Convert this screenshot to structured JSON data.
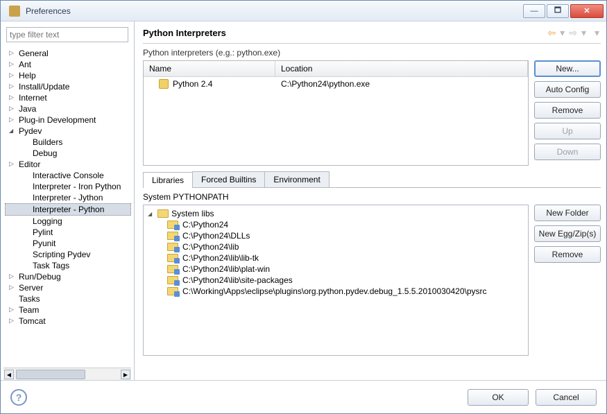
{
  "window_title": "Preferences",
  "filter_placeholder": "type filter text",
  "tree": {
    "items": [
      {
        "label": "General",
        "expandable": true
      },
      {
        "label": "Ant",
        "expandable": true
      },
      {
        "label": "Help",
        "expandable": true
      },
      {
        "label": "Install/Update",
        "expandable": true
      },
      {
        "label": "Internet",
        "expandable": true
      },
      {
        "label": "Java",
        "expandable": true
      },
      {
        "label": "Plug-in Development",
        "expandable": true
      },
      {
        "label": "Pydev",
        "expandable": true,
        "expanded": true,
        "children": [
          {
            "label": "Builders"
          },
          {
            "label": "Debug"
          },
          {
            "label": "Editor",
            "expandable": true
          },
          {
            "label": "Interactive Console"
          },
          {
            "label": "Interpreter - Iron Python"
          },
          {
            "label": "Interpreter - Jython"
          },
          {
            "label": "Interpreter - Python",
            "selected": true
          },
          {
            "label": "Logging"
          },
          {
            "label": "Pylint"
          },
          {
            "label": "Pyunit"
          },
          {
            "label": "Scripting Pydev"
          },
          {
            "label": "Task Tags"
          }
        ]
      },
      {
        "label": "Run/Debug",
        "expandable": true
      },
      {
        "label": "Server",
        "expandable": true
      },
      {
        "label": "Tasks"
      },
      {
        "label": "Team",
        "expandable": true
      },
      {
        "label": "Tomcat",
        "expandable": true
      }
    ]
  },
  "page": {
    "title": "Python Interpreters",
    "subheading": "Python interpreters (e.g.: python.exe)",
    "columns": {
      "name": "Name",
      "location": "Location"
    },
    "interpreters": [
      {
        "name": "Python 2.4",
        "location": "C:\\Python24\\python.exe"
      }
    ],
    "buttons": {
      "new": "New...",
      "auto": "Auto Config",
      "remove": "Remove",
      "up": "Up",
      "down": "Down"
    },
    "tabs": {
      "libraries": "Libraries",
      "builtins": "Forced Builtins",
      "env": "Environment"
    },
    "pp_label": "System PYTHONPATH",
    "libs_root": "System libs",
    "libs": [
      "C:\\Python24",
      "C:\\Python24\\DLLs",
      "C:\\Python24\\lib",
      "C:\\Python24\\lib\\lib-tk",
      "C:\\Python24\\lib\\plat-win",
      "C:\\Python24\\lib\\site-packages",
      "C:\\Working\\Apps\\eclipse\\plugins\\org.python.pydev.debug_1.5.5.2010030420\\pysrc"
    ],
    "lib_buttons": {
      "newfolder": "New Folder",
      "newegg": "New Egg/Zip(s)",
      "remove": "Remove"
    }
  },
  "footer": {
    "ok": "OK",
    "cancel": "Cancel"
  }
}
